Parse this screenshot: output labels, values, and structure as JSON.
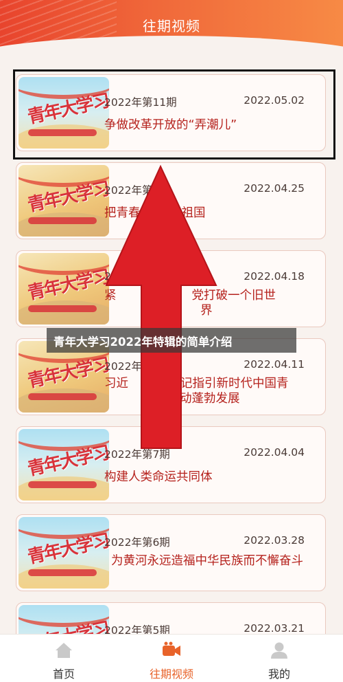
{
  "header": {
    "title": "往期视频"
  },
  "episodes": [
    {
      "issue": "2022年第11期",
      "date": "2022.05.02",
      "title": "争做改革开放的“弄潮儿”",
      "thumb_logo": "青年大学习"
    },
    {
      "issue": "2022年第",
      "date": "2022.04.25",
      "title": "把青春",
      "title2": "祖国",
      "thumb_logo": "青年大学习"
    },
    {
      "issue": "2022",
      "date": "2022.04.18",
      "title": "紧",
      "title2": "党打破一个旧世",
      "title3": "界",
      "thumb_logo": "青年大学习"
    },
    {
      "issue": "2022年",
      "date": "2022.04.11",
      "title": "习近",
      "title2": "记指引新时代中国青",
      "title3": "动蓬勃发展",
      "thumb_logo": "青年大学习"
    },
    {
      "issue": "2022年第7期",
      "date": "2022.04.04",
      "title": "构建人类命运共同体",
      "thumb_logo": "青年大学习"
    },
    {
      "issue": "2022年第6期",
      "date": "2022.03.28",
      "title": "为黄河永远造福中华民族而不懈奋斗",
      "thumb_logo": "青年大学习"
    },
    {
      "issue": "2022年第5期",
      "date": "2022.03.21",
      "title": "",
      "thumb_logo": "青年大学习"
    }
  ],
  "overlay": {
    "caption": "青年大学习2022年特辑的简单介绍"
  },
  "tabs": [
    {
      "label": "首页",
      "icon": "home-icon"
    },
    {
      "label": "往期视频",
      "icon": "video-camera-icon"
    },
    {
      "label": "我的",
      "icon": "user-icon"
    }
  ],
  "colors": {
    "accent": "#e8632a",
    "title_red": "#b5221d",
    "arrow_red": "#dd1f26"
  }
}
